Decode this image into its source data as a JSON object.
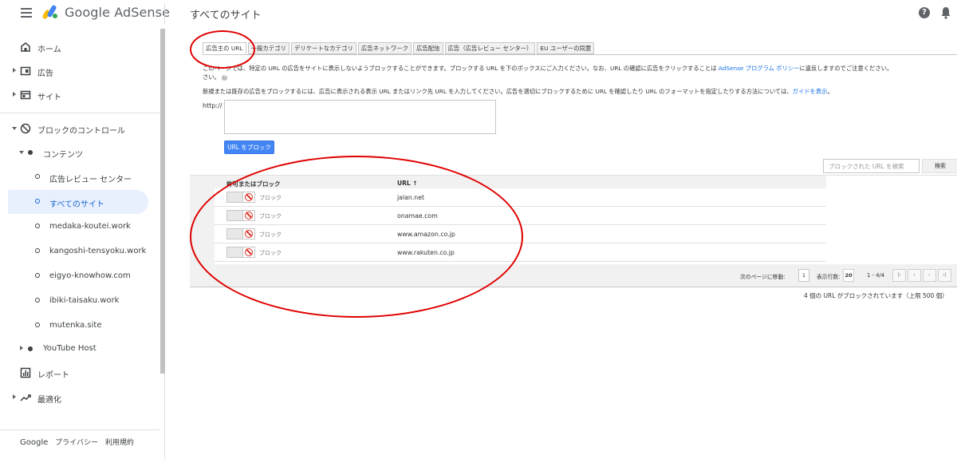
{
  "header": {
    "product_name": "Google AdSense",
    "page_title": "すべてのサイト",
    "help_label": "?"
  },
  "sidebar": {
    "items": [
      {
        "label": "ホーム"
      },
      {
        "label": "広告"
      },
      {
        "label": "サイト"
      },
      {
        "label": "ブロックのコントロール"
      },
      {
        "label": "コンテンツ"
      },
      {
        "label": "広告レビュー センター"
      },
      {
        "label": "すべてのサイト"
      },
      {
        "label": "medaka-koutei.work"
      },
      {
        "label": "kangoshi-tensyoku.work"
      },
      {
        "label": "eigyo-knowhow.com"
      },
      {
        "label": "ibiki-taisaku.work"
      },
      {
        "label": "mutenka.site"
      },
      {
        "label": "YouTube Host"
      },
      {
        "label": "レポート"
      },
      {
        "label": "最適化"
      }
    ],
    "footer": {
      "google": "Google",
      "privacy": "プライバシー",
      "terms": "利用規約"
    }
  },
  "tabs": [
    {
      "label": "広告主の URL"
    },
    {
      "label": "一般カテゴリ"
    },
    {
      "label": "デリケートなカテゴリ"
    },
    {
      "label": "広告ネットワーク"
    },
    {
      "label": "広告配信"
    },
    {
      "label": "広告（広告レビュー センター）"
    },
    {
      "label": "EU ユーザーの同意"
    }
  ],
  "description": {
    "line1": "このページでは、特定の URL の広告をサイトに表示しないようブロックすることができます。ブロックする URL を下のボックスにご入力ください。なお、URL の確認に広告をクリックすることは ",
    "policy_link": "AdSense プログラム ポリシー",
    "line1_end": "に違反しますのでご注意ください。",
    "line2": "さい。",
    "line3": "新規または既存の広告をブロックするには、広告に表示される表示 URL またはリンク先 URL を入力してください。広告を適切にブロックするために URL を確認したり URL のフォーマットを指定したりする方法については、",
    "guide_link": "ガイドを表示",
    "line3_end": "。"
  },
  "form": {
    "prefix": "http://",
    "textarea_value": "",
    "block_button": "URL をブロック",
    "search_placeholder": "ブロックされた URL を検索",
    "search_button": "検索"
  },
  "table": {
    "headers": {
      "status": "許可またはブロック",
      "url": "URL ↑"
    },
    "rows": [
      {
        "status": "ブロック",
        "url": "jalan.net"
      },
      {
        "status": "ブロック",
        "url": "onamae.com"
      },
      {
        "status": "ブロック",
        "url": "www.amazon.co.jp"
      },
      {
        "status": "ブロック",
        "url": "www.rakuten.co.jp"
      }
    ]
  },
  "pager": {
    "goto_label": "次のページに移動:",
    "page_value": "1",
    "rows_label": "表示行数:",
    "rows_value": "20",
    "range": "1 - 4/4",
    "first": "|‹",
    "prev": "‹",
    "next": "›",
    "last": "›|"
  },
  "summary": "4 個の URL がブロックされています（上限 500 個）",
  "colors": {
    "accent": "#1a73e8",
    "button": "#4285f4",
    "annotation": "#e00000"
  }
}
